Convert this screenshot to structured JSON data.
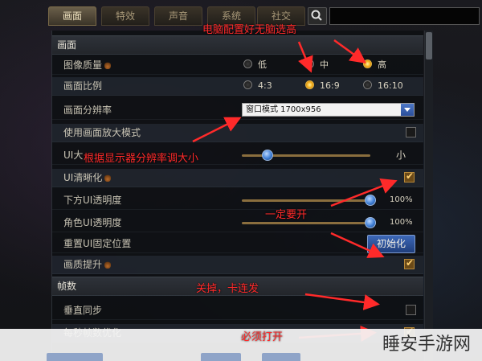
{
  "tabs": [
    "画面",
    "特效",
    "声音",
    "系统",
    "社交"
  ],
  "rows": {
    "section_display": "画面",
    "image_quality": "图像质量",
    "quality_options": [
      "低",
      "中",
      "高"
    ],
    "aspect_ratio": "画面比例",
    "aspect_options": [
      "4:3",
      "16:9",
      "16:10"
    ],
    "resolution": "画面分辨率",
    "resolution_value": "窗口模式 1700x956",
    "zoom_mode": "使用画面放大模式",
    "ui_size": "UI大",
    "ui_size_value": "小",
    "ui_sharpen": "UI清晰化",
    "lower_ui_opacity": "下方UI透明度",
    "lower_ui_opacity_value": "100%",
    "role_ui_opacity": "角色UI透明度",
    "role_ui_opacity_value": "100%",
    "reset_ui": "重置UI固定位置",
    "reset_button": "初始化",
    "quality_boost": "画质提升",
    "section_fps": "帧数",
    "vsync": "垂直同步",
    "fps_opt": "每秒帧数优化"
  },
  "state": {
    "quality_selected": "高",
    "aspect_selected": "16:9",
    "zoom_mode_checked": false,
    "ui_sharpen_checked": true,
    "quality_boost_checked": true,
    "vsync_checked": false,
    "fps_opt_checked": true,
    "ui_size_level": 0.2,
    "lower_ui_opacity_level": 1.0,
    "role_ui_opacity_level": 1.0
  },
  "annotations": {
    "a1": "电脑配置好无脑选高",
    "a2": "根据显示器分辨率调大小",
    "a3": "一定要开",
    "a4": "关掉，卡连发",
    "a5": "必须打开"
  },
  "watermark": "睡安手游网",
  "colors": {
    "annotation": "#ff2a2a",
    "accent_blue": "#3f7fd6",
    "radio_on": "#f2a816"
  }
}
